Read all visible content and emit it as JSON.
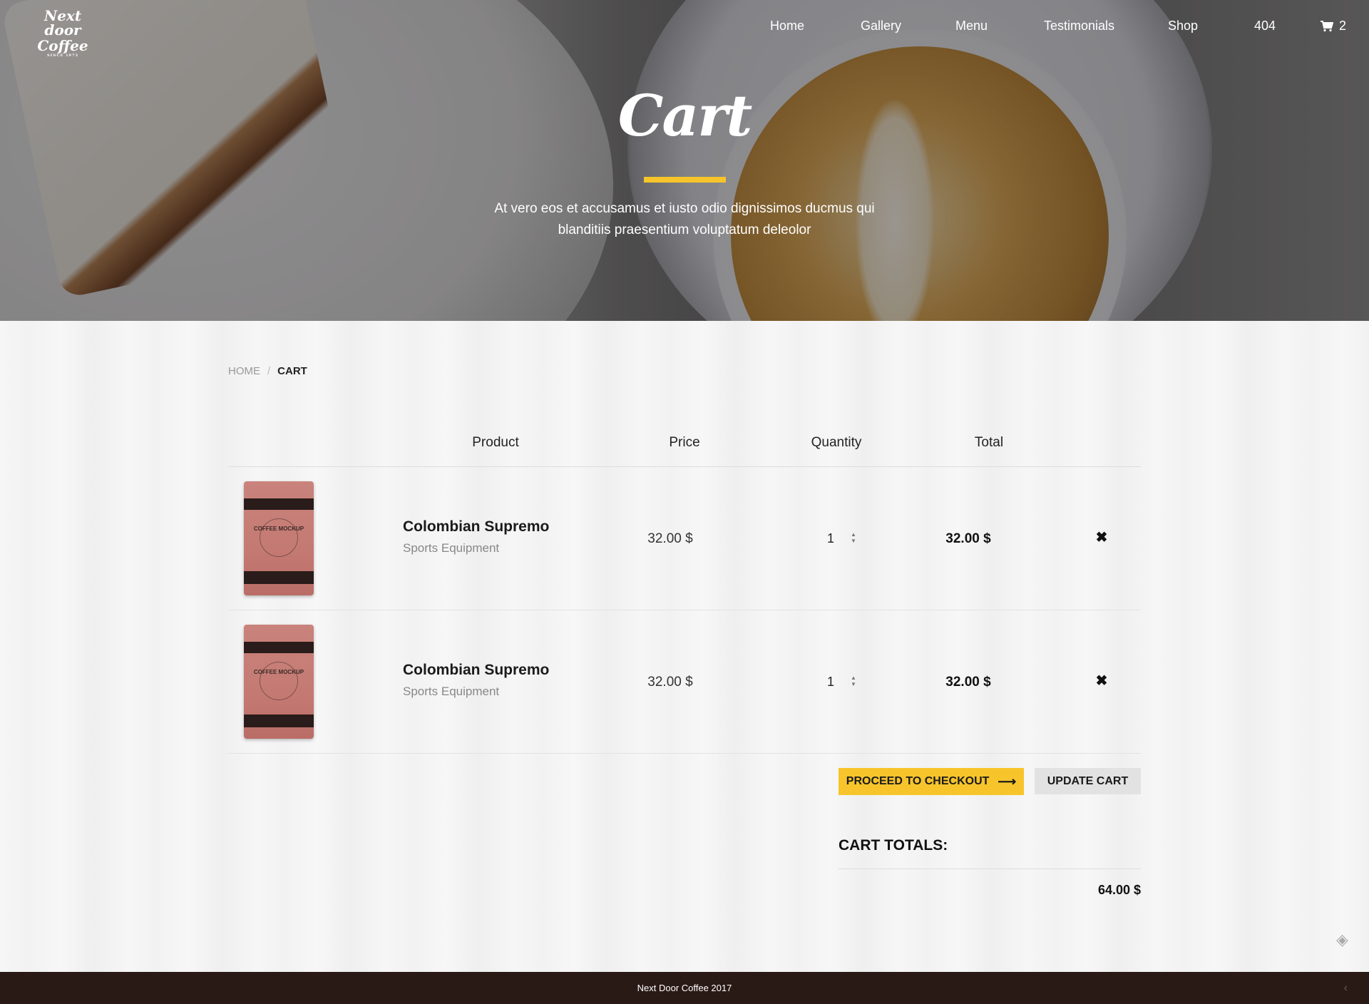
{
  "brand": {
    "line1": "Next door",
    "line2": "Coffee",
    "line3": "SINCE 1973"
  },
  "nav": {
    "items": [
      "Home",
      "Gallery",
      "Menu",
      "Testimonials",
      "Shop",
      "404"
    ],
    "cart_count": "2"
  },
  "hero": {
    "title": "Cart",
    "text": "At vero eos et accusamus et iusto odio dignissimos ducmus qui blanditiis praesentium voluptatum deleolor",
    "accent_color": "#f7c52b"
  },
  "breadcrumb": {
    "home": "HOME",
    "separator": "/",
    "current": "CART"
  },
  "table": {
    "headers": {
      "product": "Product",
      "price": "Price",
      "quantity": "Quantity",
      "total": "Total"
    },
    "rows": [
      {
        "bag_label": "COFFEE MOCKUP",
        "name": "Colombian Supremo",
        "category": "Sports Equipment",
        "price": "32.00 $",
        "quantity": "1",
        "total": "32.00 $",
        "remove_icon": "close-icon"
      },
      {
        "bag_label": "COFFEE MOCKUP",
        "name": "Colombian Supremo",
        "category": "Sports Equipment",
        "price": "32.00 $",
        "quantity": "1",
        "total": "32.00 $",
        "remove_icon": "close-icon"
      }
    ]
  },
  "actions": {
    "checkout": "PROCEED TO CHECKOUT",
    "update": "UPDATE CART"
  },
  "totals": {
    "title": "CART TOTALS:",
    "value": "64.00 $"
  },
  "footer": {
    "text": "Next Door Coffee 2017"
  }
}
